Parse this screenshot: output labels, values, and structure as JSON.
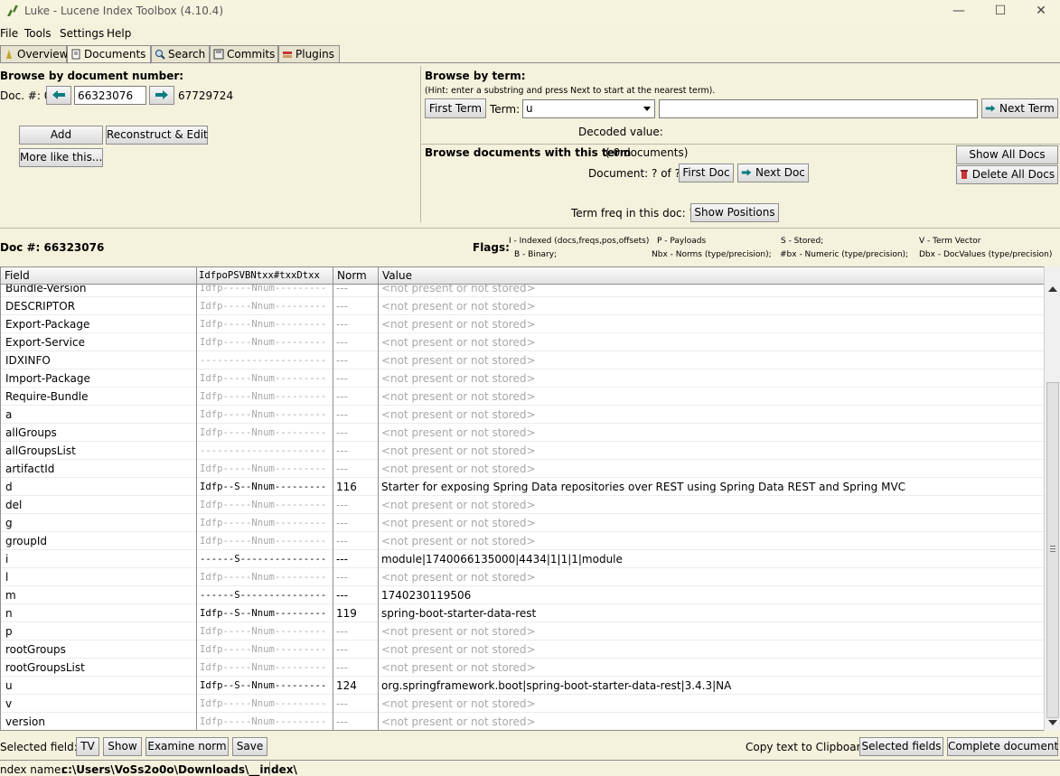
{
  "window": {
    "title": "Luke - Lucene Index Toolbox (4.10.4)",
    "minimize": "—",
    "maximize": "☐",
    "close": "✕"
  },
  "menu": [
    {
      "label": "File"
    },
    {
      "label": "Tools"
    },
    {
      "label": "Settings"
    },
    {
      "label": "Help"
    }
  ],
  "tabs": [
    {
      "label": "Overview"
    },
    {
      "label": "Documents"
    },
    {
      "label": "Search"
    },
    {
      "label": "Commits"
    },
    {
      "label": "Plugins"
    }
  ],
  "browse_doc": {
    "heading": "Browse by document number:",
    "doc_label": "Doc. #: 0",
    "doc_value": "66323076",
    "max_doc": "67729724",
    "add": "Add",
    "reconstruct": "Reconstruct & Edit",
    "more_like": "More like this..."
  },
  "browse_term": {
    "heading": "Browse by term:",
    "hint": "(Hint: enter a substring and press Next to start at the nearest term).",
    "first_term": "First Term",
    "term_label": "Term:",
    "term_field": "u",
    "term_text": "",
    "next_term": "Next Term",
    "decoded_label": "Decoded value:"
  },
  "browse_docs_term": {
    "heading": "Browse documents with this term",
    "count": "( 0 documents)",
    "doc_pos": "Document: ?  of  ?",
    "first_doc": "First Doc",
    "next_doc": "Next Doc",
    "show_all": "Show All Docs",
    "delete_all": "Delete All Docs",
    "term_freq": "Term freq in this doc:  ?",
    "show_positions": "Show Positions"
  },
  "doc_info": {
    "doc_num": "Doc #: 66323076",
    "flags_label": "Flags:",
    "legend": [
      "I - Indexed (docs,freqs,pos,offsets)",
      "P - Payloads",
      "S - Stored;",
      "V - Term Vector",
      "B - Binary;",
      "Nbx - Norms (type/precision);",
      "#bx - Numeric (type/precision);",
      "Dbx - DocValues (type/precision)"
    ]
  },
  "table": {
    "headers": [
      "Field",
      "IdfpoPSVBNtxx#txxDtxx",
      "Norm",
      "Value"
    ],
    "rows": [
      {
        "field": "Bundle-Version",
        "flags": "Idfp-----Nnum---------",
        "norm": "---",
        "value": "<not present or not stored>",
        "present": false
      },
      {
        "field": "DESCRIPTOR",
        "flags": "Idfp-----Nnum---------",
        "norm": "---",
        "value": "<not present or not stored>",
        "present": false
      },
      {
        "field": "Export-Package",
        "flags": "Idfp-----Nnum---------",
        "norm": "---",
        "value": "<not present or not stored>",
        "present": false
      },
      {
        "field": "Export-Service",
        "flags": "Idfp-----Nnum---------",
        "norm": "---",
        "value": "<not present or not stored>",
        "present": false
      },
      {
        "field": "IDXINFO",
        "flags": "----------------------",
        "norm": "---",
        "value": "<not present or not stored>",
        "present": false
      },
      {
        "field": "Import-Package",
        "flags": "Idfp-----Nnum---------",
        "norm": "---",
        "value": "<not present or not stored>",
        "present": false
      },
      {
        "field": "Require-Bundle",
        "flags": "Idfp-----Nnum---------",
        "norm": "---",
        "value": "<not present or not stored>",
        "present": false
      },
      {
        "field": "a",
        "flags": "Idfp-----Nnum---------",
        "norm": "---",
        "value": "<not present or not stored>",
        "present": false
      },
      {
        "field": "allGroups",
        "flags": "Idfp-----Nnum---------",
        "norm": "---",
        "value": "<not present or not stored>",
        "present": false
      },
      {
        "field": "allGroupsList",
        "flags": "----------------------",
        "norm": "---",
        "value": "<not present or not stored>",
        "present": false
      },
      {
        "field": "artifactId",
        "flags": "Idfp-----Nnum---------",
        "norm": "---",
        "value": "<not present or not stored>",
        "present": false
      },
      {
        "field": "d",
        "flags": "Idfp--S--Nnum---------",
        "norm": "116",
        "value": "Starter for exposing Spring Data repositories over REST using Spring Data REST and Spring MVC",
        "present": true
      },
      {
        "field": "del",
        "flags": "Idfp-----Nnum---------",
        "norm": "---",
        "value": "<not present or not stored>",
        "present": false
      },
      {
        "field": "g",
        "flags": "Idfp-----Nnum---------",
        "norm": "---",
        "value": "<not present or not stored>",
        "present": false
      },
      {
        "field": "groupId",
        "flags": "Idfp-----Nnum---------",
        "norm": "---",
        "value": "<not present or not stored>",
        "present": false
      },
      {
        "field": "i",
        "flags": "------S---------------",
        "norm": "---",
        "value": "module|1740066135000|4434|1|1|1|module",
        "present": true
      },
      {
        "field": "l",
        "flags": "Idfp-----Nnum---------",
        "norm": "---",
        "value": "<not present or not stored>",
        "present": false
      },
      {
        "field": "m",
        "flags": "------S---------------",
        "norm": "---",
        "value": "1740230119506",
        "present": true
      },
      {
        "field": "n",
        "flags": "Idfp--S--Nnum---------",
        "norm": "119",
        "value": "spring-boot-starter-data-rest",
        "present": true
      },
      {
        "field": "p",
        "flags": "Idfp-----Nnum---------",
        "norm": "---",
        "value": "<not present or not stored>",
        "present": false
      },
      {
        "field": "rootGroups",
        "flags": "Idfp-----Nnum---------",
        "norm": "---",
        "value": "<not present or not stored>",
        "present": false
      },
      {
        "field": "rootGroupsList",
        "flags": "Idfp-----Nnum---------",
        "norm": "---",
        "value": "<not present or not stored>",
        "present": false
      },
      {
        "field": "u",
        "flags": "Idfp--S--Nnum---------",
        "norm": "124",
        "value": "org.springframework.boot|spring-boot-starter-data-rest|3.4.3|NA",
        "present": true
      },
      {
        "field": "v",
        "flags": "Idfp-----Nnum---------",
        "norm": "---",
        "value": "<not present or not stored>",
        "present": false
      },
      {
        "field": "version",
        "flags": "Idfp-----Nnum---------",
        "norm": "---",
        "value": "<not present or not stored>",
        "present": false
      }
    ]
  },
  "bottom": {
    "selected_field_label": "Selected field:",
    "tv": "TV",
    "show": "Show",
    "examine_norm": "Examine norm",
    "save": "Save",
    "copy_label": "Copy text to Clipboard:",
    "selected_fields": "Selected fields",
    "complete_document": "Complete document"
  },
  "status": {
    "index_label": "ndex name:",
    "index_path": "c:\\Users\\VoSs2o0o\\Downloads\\__index\\"
  },
  "colors": {
    "background": "#f4f1dc",
    "dim_text": "#a8a8a8",
    "arrow_button": "#0a7c80"
  }
}
